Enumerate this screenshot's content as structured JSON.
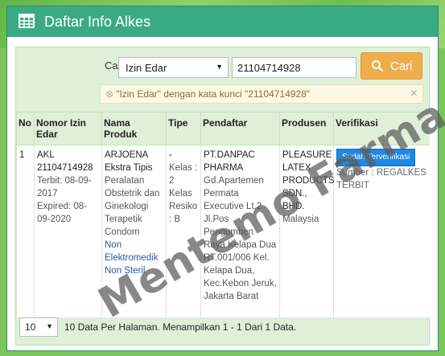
{
  "header": {
    "title": "Daftar Info Alkes",
    "icon": "table-icon"
  },
  "search": {
    "label": "Cari",
    "field_select": "Izin Edar",
    "keyword": "21104714928",
    "button_label": "Cari",
    "active_filter": "\"Izin Edar\" dengan kata kunci \"21104714928\""
  },
  "table": {
    "headers": [
      "No",
      "Nomor Izin Edar",
      "Nama Produk",
      "Tipe",
      "Pendaftar",
      "Produsen",
      "Verifikasi"
    ],
    "rows": [
      {
        "no": "1",
        "izin_no": "AKL 21104714928",
        "terbit": "Terbit: 08-09-2017",
        "expired": "Expired: 08-09-2020",
        "product_name": "ARJOENA Ekstra Tipis",
        "product_category": "Peralatan Obstetrik dan Ginekologi Terapetik Condom",
        "product_class": "Non Elektromedik Non Steril",
        "tipe_dash": "-",
        "tipe_detail": "Kelas : 2 Kelas Resiko : B",
        "pendaftar_name": "PT.DANPAC PHARMA",
        "pendaftar_address": "Gd.Apartemen Permata Executive Lt.2 Jl.Pos Pengumben Raya Kelapa Dua RT.001/006 Kel. Kelapa Dua, Kec.Kebon Jeruk, Jakarta Barat",
        "produsen_name": "PLEASURE LATEX PRODUCTS SDN., BHD.",
        "produsen_country": "Malaysia",
        "verif_badge": "Sudah Terverifikasi",
        "verif_source": "Sumber : REGALKES TERBIT"
      }
    ]
  },
  "footer": {
    "per_page": "10",
    "info": "10 Data Per Halaman. Menampilkan 1 - 1 Dari 1 Data."
  },
  "watermark": "Mentemo Farma",
  "colors": {
    "header_bg": "#3aaa85",
    "body_bg": "#dff0d8",
    "search_button": "#f0ad4e",
    "badge": "#1e88e5"
  }
}
